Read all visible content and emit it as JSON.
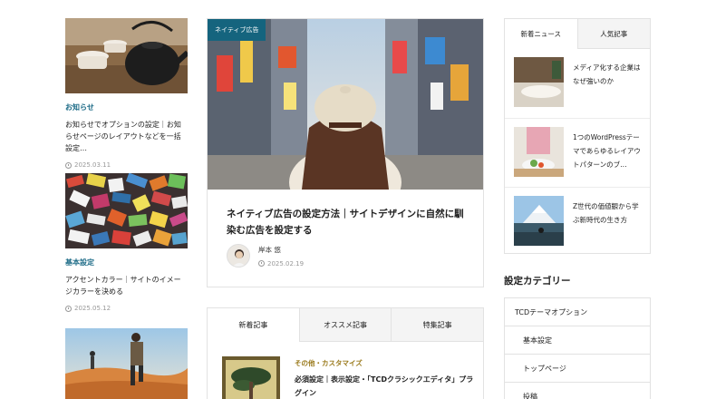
{
  "left_cards": [
    {
      "category": "お知らせ",
      "title": "お知らせでオプションの設定｜お知らせページのレイアウトなどを一括設定…",
      "date": "2025.03.11"
    },
    {
      "category": "基本設定",
      "title": "アクセントカラー｜サイトのイメージカラーを決める",
      "date": "2025.05.12"
    },
    {
      "category": "",
      "title": "",
      "date": ""
    }
  ],
  "featured": {
    "badge": "ネイティブ広告",
    "title": "ネイティブ広告の設定方法｜サイトデザインに自然に馴染む広告を設定する",
    "author": "岸本 悠",
    "date": "2025.02.19"
  },
  "article_tabs": {
    "tabs": [
      "新着記事",
      "オススメ記事",
      "特集記事"
    ],
    "active_index": 0,
    "items": [
      {
        "category": "その他・カスタマイズ",
        "title": "必須設定｜表示設定・「TCDクラシックエディタ」プラグイン"
      }
    ]
  },
  "news_box": {
    "tabs": [
      "新着ニュース",
      "人気記事"
    ],
    "active_index": 0,
    "items": [
      {
        "title": "メディア化する企業はなぜ強いのか"
      },
      {
        "title": "1つのWordPressテーマであらゆるレイアウトパターンのブ…"
      },
      {
        "title": "Z世代の価値観から学ぶ新時代の生き方"
      }
    ]
  },
  "category_section": {
    "heading": "設定カテゴリー",
    "items": [
      {
        "label": "TCDテーマオプション",
        "level": 0
      },
      {
        "label": "基本設定",
        "level": 1
      },
      {
        "label": "トップページ",
        "level": 1
      },
      {
        "label": "投稿",
        "level": 1
      }
    ]
  },
  "colors": {
    "accent": "#15647e",
    "category_gold": "#9a7a1c",
    "border": "#e2e2e2",
    "tab_inactive": "#f4f4f4"
  }
}
